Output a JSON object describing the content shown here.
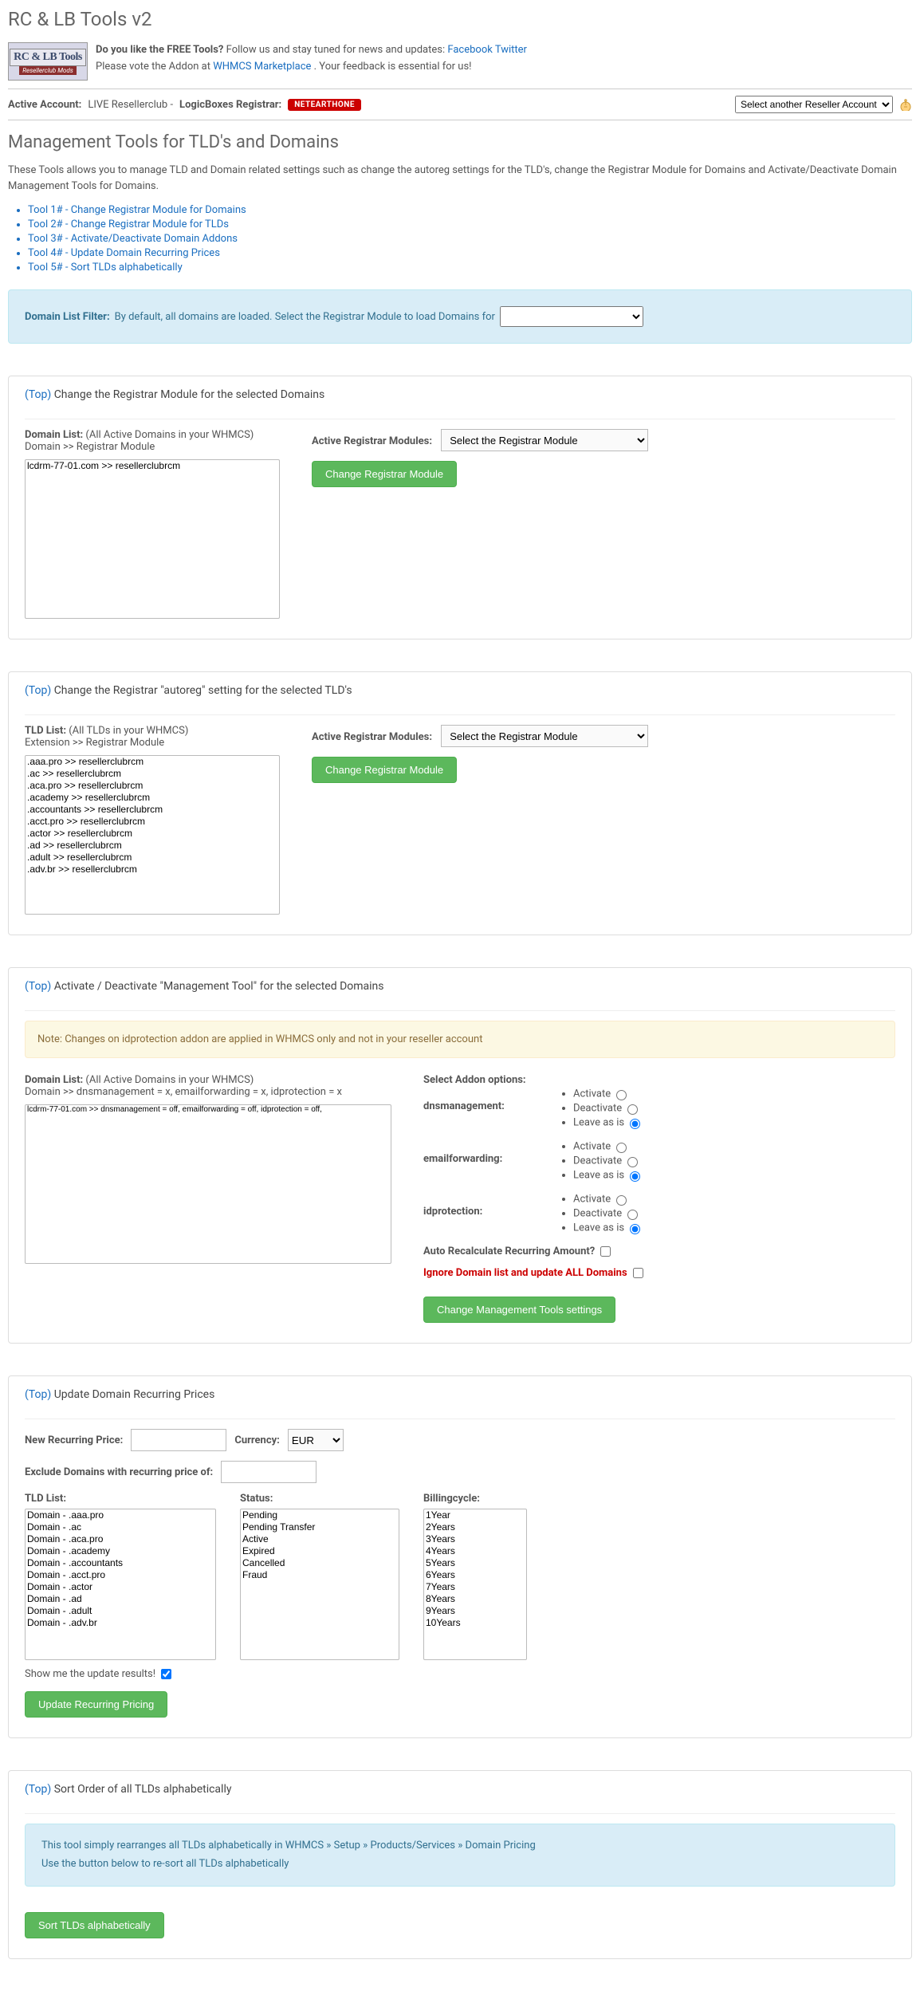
{
  "page_title": "RC & LB Tools v2",
  "logo": {
    "main": "RC & LB Tools",
    "sub": "Resellerclub Mods"
  },
  "header": {
    "line1_prefix": "Do you like the FREE Tools?",
    "line1_text": " Follow us and stay tuned for news and updates: ",
    "fb": "Facebook",
    "tw": "Twitter",
    "line2_prefix": "Please vote the Addon at ",
    "line2_link": "WHMCS Marketplace",
    "line2_suffix": ". Your feedback is essential for us!"
  },
  "account_bar": {
    "active_label": "Active Account:",
    "active_value": " LIVE Resellerclub - ",
    "registrar_label": "LogicBoxes Registrar:",
    "registrar_badge": "NETEARTHONE",
    "select_placeholder": "Select another Reseller Account"
  },
  "section_title": "Management Tools for TLD's and Domains",
  "intro_text": "These Tools allows you to manage TLD and Domain related settings such as change the autoreg settings for the TLD's, change the Registrar Module for Domains and Activate/Deactivate Domain Management Tools for Domains.",
  "tool_links": [
    "Tool 1# - Change Registrar Module for Domains",
    "Tool 2# - Change Registrar Module for TLDs",
    "Tool 3# - Activate/Deactivate Domain Addons",
    "Tool 4# - Update Domain Recurring Prices",
    "Tool 5# - Sort TLDs alphabetically"
  ],
  "filter": {
    "label": "Domain List Filter: ",
    "text": "By default, all domains are loaded. Select the Registrar Module to load Domains for "
  },
  "top_link": "(Top)",
  "tool1": {
    "heading": " Change the Registrar Module for the selected Domains",
    "domain_list_label": "Domain List:",
    "domain_list_hint": " (All Active Domains in your WHMCS)",
    "domain_list_sub": "Domain >> Registrar Module",
    "domains": [
      "lcdrm-77-01.com >> resellerclubrcm"
    ],
    "reg_label": "Active Registrar Modules:",
    "reg_placeholder": "Select the Registrar Module",
    "button": "Change Registrar Module"
  },
  "tool2": {
    "heading": " Change the Registrar \"autoreg\" setting for the selected TLD's",
    "tld_list_label": "TLD List:",
    "tld_list_hint": " (All TLDs in your WHMCS)",
    "tld_list_sub": "Extension >> Registrar Module",
    "tlds": [
      ".aaa.pro >> resellerclubrcm",
      ".ac >> resellerclubrcm",
      ".aca.pro >> resellerclubrcm",
      ".academy >> resellerclubrcm",
      ".accountants >> resellerclubrcm",
      ".acct.pro >> resellerclubrcm",
      ".actor >> resellerclubrcm",
      ".ad >> resellerclubrcm",
      ".adult >> resellerclubrcm",
      ".adv.br >> resellerclubrcm"
    ],
    "reg_label": "Active Registrar Modules:",
    "reg_placeholder": "Select the Registrar Module",
    "button": "Change Registrar Module"
  },
  "tool3": {
    "heading": " Activate / Deactivate \"Management Tool\" for the selected Domains",
    "note": "Note: Changes on idprotection addon are applied in WHMCS only and not in your reseller account",
    "domain_list_label": "Domain List:",
    "domain_list_hint": " (All Active Domains in your WHMCS)",
    "domain_list_sub": "Domain >> dnsmanagement = x, emailforwarding = x, idprotection = x",
    "domains": [
      "lcdrm-77-01.com >> dnsmanagement = off, emailforwarding = off, idprotection = off,"
    ],
    "select_addon_label": "Select Addon options:",
    "addon_rows": [
      {
        "label": "dnsmanagement:",
        "activate": "Activate",
        "deactivate": "Deactivate",
        "leave": "Leave as is"
      },
      {
        "label": "emailforwarding:",
        "activate": "Activate",
        "deactivate": "Deactivate",
        "leave": "Leave as is"
      },
      {
        "label": "idprotection:",
        "activate": "Activate",
        "deactivate": "Deactivate",
        "leave": "Leave as is"
      }
    ],
    "auto_recalc": "Auto Recalculate Recurring Amount?",
    "ignore_all": "Ignore Domain list and update ALL Domains",
    "button": "Change Management Tools settings"
  },
  "tool4": {
    "heading": " Update Domain Recurring Prices",
    "new_price_label": "New Recurring Price:",
    "currency_label": "Currency:",
    "currency_value": "EUR",
    "exclude_label": "Exclude Domains with recurring price of:",
    "tld_label": "TLD List:",
    "tlds": [
      "Domain - .aaa.pro",
      "Domain - .ac",
      "Domain - .aca.pro",
      "Domain - .academy",
      "Domain - .accountants",
      "Domain - .acct.pro",
      "Domain - .actor",
      "Domain - .ad",
      "Domain - .adult",
      "Domain - .adv.br"
    ],
    "status_label": "Status:",
    "statuses": [
      "Pending",
      "Pending Transfer",
      "Active",
      "Expired",
      "Cancelled",
      "Fraud"
    ],
    "billing_label": "Billingcycle:",
    "billings": [
      "1Year",
      "2Years",
      "3Years",
      "4Years",
      "5Years",
      "6Years",
      "7Years",
      "8Years",
      "9Years",
      "10Years"
    ],
    "show_results": "Show me the update results!",
    "button": "Update Recurring Pricing"
  },
  "tool5": {
    "heading": " Sort Order of all TLDs alphabetically",
    "info_line1": "This tool simply rearranges all TLDs alphabetically in WHMCS » Setup » Products/Services » Domain Pricing",
    "info_line2": "Use the button below to re-sort all TLDs alphabetically",
    "button": "Sort TLDs alphabetically"
  }
}
